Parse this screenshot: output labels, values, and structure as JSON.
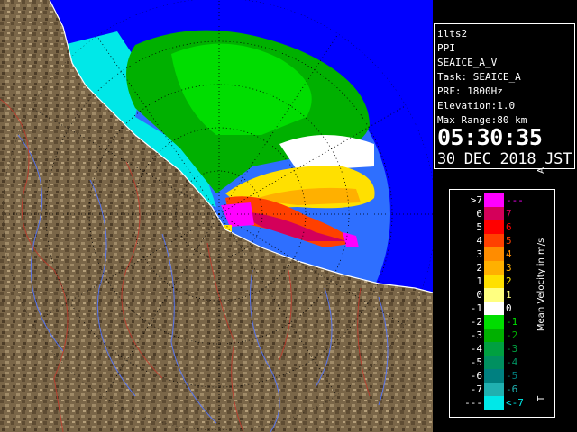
{
  "info": {
    "radar": "ilts2",
    "scan": "PPI",
    "product": "SEAICE_A_V",
    "task": "Task: SEAICE_A",
    "prf": "PRF: 1800Hz",
    "elevation": "Elevation:1.0",
    "range": "Max Range:80 km",
    "time": "05:30:35",
    "date": "30 DEC 2018 JST"
  },
  "legend": {
    "title": "Mean Velocity in m/s",
    "top_marker": "A",
    "bottom_marker": "T",
    "rows": [
      {
        "low": ">7",
        "high": "---",
        "color": "#ff00ff"
      },
      {
        "low": "6",
        "high": "7",
        "color": "#d4005a"
      },
      {
        "low": "5",
        "high": "6",
        "color": "#ff0000"
      },
      {
        "low": "4",
        "high": "5",
        "color": "#ff4000"
      },
      {
        "low": "3",
        "high": "4",
        "color": "#ff8c00"
      },
      {
        "low": "2",
        "high": "3",
        "color": "#ffb000"
      },
      {
        "low": "1",
        "high": "2",
        "color": "#ffe000"
      },
      {
        "low": "0",
        "high": "1",
        "color": "#ffff80"
      },
      {
        "low": "-1",
        "high": "0",
        "color": "#ffffff"
      },
      {
        "low": "-2",
        "high": "-1",
        "color": "#00dd00"
      },
      {
        "low": "-3",
        "high": "-2",
        "color": "#00b000"
      },
      {
        "low": "-4",
        "high": "-3",
        "color": "#00a040"
      },
      {
        "low": "-5",
        "high": "-4",
        "color": "#009060"
      },
      {
        "low": "-6",
        "high": "-5",
        "color": "#008080"
      },
      {
        "low": "-7",
        "high": "-6",
        "color": "#20b0b0"
      },
      {
        "low": "---",
        "high": "<-7",
        "color": "#00e8e8"
      }
    ]
  },
  "map": {
    "sea_color": "#0000ff",
    "coverage_color": "#2e6fff",
    "land_color": "#7a6648"
  }
}
